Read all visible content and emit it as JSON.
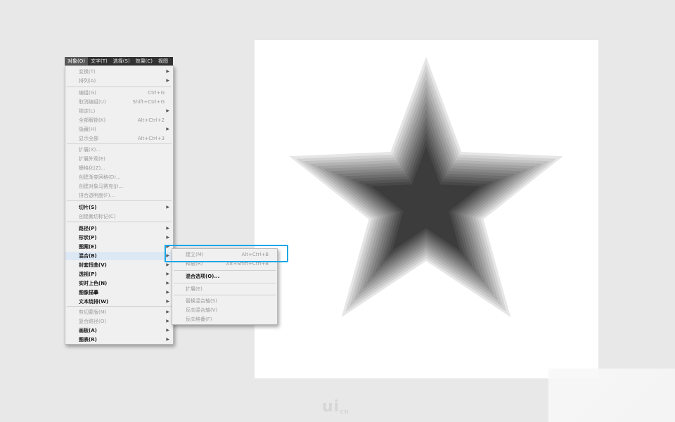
{
  "menubar": {
    "items": [
      "对象(O)",
      "文字(T)",
      "选择(S)",
      "效果(C)",
      "视图"
    ]
  },
  "object_menu": {
    "items": [
      {
        "label": "变换(T)",
        "shortcut": "",
        "submenu": true,
        "enabled": false
      },
      {
        "label": "排列(A)",
        "shortcut": "",
        "submenu": true,
        "enabled": false
      },
      {
        "label": "编组(G)",
        "shortcut": "Ctrl+G",
        "submenu": false,
        "enabled": false
      },
      {
        "label": "取消编组(U)",
        "shortcut": "Shift+Ctrl+G",
        "submenu": false,
        "enabled": false
      },
      {
        "label": "锁定(L)",
        "shortcut": "",
        "submenu": true,
        "enabled": false
      },
      {
        "label": "全部解锁(K)",
        "shortcut": "Alt+Ctrl+2",
        "submenu": false,
        "enabled": false
      },
      {
        "label": "隐藏(H)",
        "shortcut": "",
        "submenu": true,
        "enabled": false
      },
      {
        "label": "显示全部",
        "shortcut": "Alt+Ctrl+3",
        "submenu": false,
        "enabled": false
      },
      {
        "label": "扩展(X)...",
        "shortcut": "",
        "submenu": false,
        "enabled": false
      },
      {
        "label": "扩展外观(E)",
        "shortcut": "",
        "submenu": false,
        "enabled": false
      },
      {
        "label": "栅格化(Z)...",
        "shortcut": "",
        "submenu": false,
        "enabled": false
      },
      {
        "label": "创建渐变网格(D)...",
        "shortcut": "",
        "submenu": false,
        "enabled": false
      },
      {
        "label": "创建对象马赛克(J)...",
        "shortcut": "",
        "submenu": false,
        "enabled": false
      },
      {
        "label": "拼合透明度(F)...",
        "shortcut": "",
        "submenu": false,
        "enabled": false
      },
      {
        "label": "切片(S)",
        "shortcut": "",
        "submenu": true,
        "enabled": true
      },
      {
        "label": "创建裁切标记(C)",
        "shortcut": "",
        "submenu": false,
        "enabled": false
      },
      {
        "label": "路径(P)",
        "shortcut": "",
        "submenu": true,
        "enabled": true
      },
      {
        "label": "形状(P)",
        "shortcut": "",
        "submenu": true,
        "enabled": true
      },
      {
        "label": "图案(E)",
        "shortcut": "",
        "submenu": true,
        "enabled": true
      },
      {
        "label": "混合(B)",
        "shortcut": "",
        "submenu": true,
        "enabled": true,
        "highlighted": true
      },
      {
        "label": "封套扭曲(V)",
        "shortcut": "",
        "submenu": true,
        "enabled": true
      },
      {
        "label": "透视(P)",
        "shortcut": "",
        "submenu": true,
        "enabled": true
      },
      {
        "label": "实时上色(N)",
        "shortcut": "",
        "submenu": true,
        "enabled": true
      },
      {
        "label": "图像描摹",
        "shortcut": "",
        "submenu": true,
        "enabled": true
      },
      {
        "label": "文本绕排(W)",
        "shortcut": "",
        "submenu": true,
        "enabled": true
      },
      {
        "label": "剪切蒙版(M)",
        "shortcut": "",
        "submenu": true,
        "enabled": false
      },
      {
        "label": "复合路径(O)",
        "shortcut": "",
        "submenu": true,
        "enabled": false
      },
      {
        "label": "画板(A)",
        "shortcut": "",
        "submenu": true,
        "enabled": true
      },
      {
        "label": "图表(R)",
        "shortcut": "",
        "submenu": true,
        "enabled": true
      }
    ]
  },
  "blend_submenu": {
    "items": [
      {
        "label": "建立(M)",
        "shortcut": "Alt+Ctrl+B",
        "enabled": false
      },
      {
        "label": "释放(R)",
        "shortcut": "Alt+Shift+Ctrl+B",
        "enabled": false
      },
      {
        "label": "混合选项(O)...",
        "shortcut": "",
        "enabled": true
      },
      {
        "label": "扩展(E)",
        "shortcut": "",
        "enabled": false
      },
      {
        "label": "替换混合轴(S)",
        "shortcut": "",
        "enabled": false
      },
      {
        "label": "反向混合轴(V)",
        "shortcut": "",
        "enabled": false
      },
      {
        "label": "反向堆叠(F)",
        "shortcut": "",
        "enabled": false
      }
    ]
  },
  "canvas": {
    "shape": "blended-star",
    "fill_dark": "#3c3c3c",
    "fill_light": "#ffffff"
  },
  "highlight_color": "#19a7e6",
  "watermark": {
    "text": "ui",
    "suffix": "cn"
  }
}
